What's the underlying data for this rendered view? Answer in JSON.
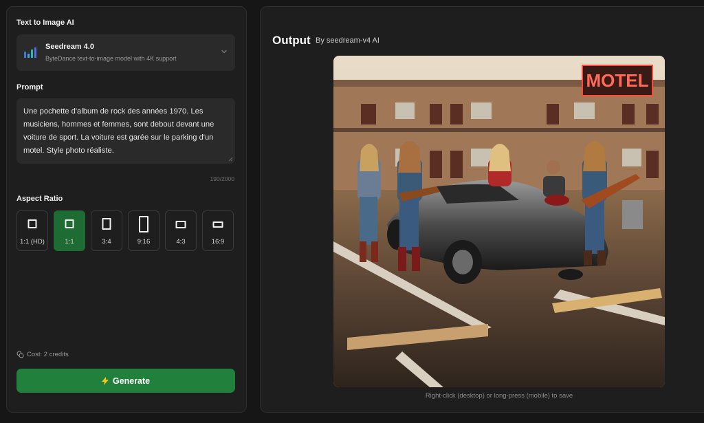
{
  "left": {
    "model_section_title": "Text to Image AI",
    "model": {
      "name": "Seedream 4.0",
      "description": "ByteDance text-to-image model with 4K support",
      "icon": "seedream-bars-icon"
    },
    "prompt_title": "Prompt",
    "prompt_text": "Une pochette d'album de rock des années 1970. Les musiciens, hommes et femmes, sont debout devant une voiture de sport. La voiture est garée sur le parking d'un motel. Style photo réaliste.",
    "char_count": "190/2000",
    "aspect_title": "Aspect Ratio",
    "aspect_ratios": [
      {
        "label": "1:1 (HD)",
        "selected": false
      },
      {
        "label": "1:1",
        "selected": true
      },
      {
        "label": "3:4",
        "selected": false
      },
      {
        "label": "9:16",
        "selected": false
      },
      {
        "label": "4:3",
        "selected": false
      },
      {
        "label": "16:9",
        "selected": false
      }
    ],
    "cost": "Cost: 2 credits",
    "generate_label": "Generate",
    "generate_icon": "lightning-icon",
    "accent_color": "#22803d"
  },
  "right": {
    "output_title": "Output",
    "output_by": "By seedream-v4 AI",
    "sign_text": "MOTEL",
    "save_hint": "Right-click (desktop) or long-press (mobile) to save"
  }
}
